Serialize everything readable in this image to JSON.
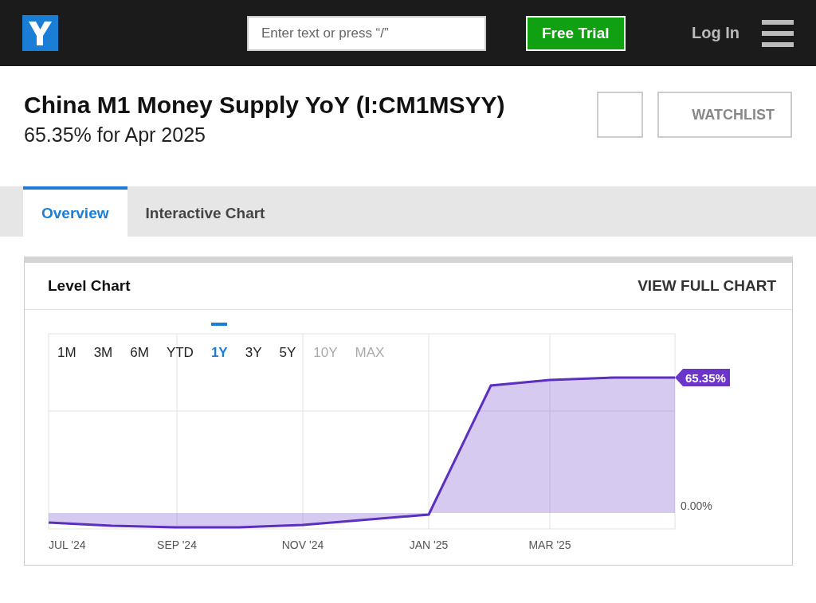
{
  "header": {
    "search": {
      "placeholder": "Enter text or press “/”"
    },
    "trial_button": "Free Trial",
    "login": "Log In"
  },
  "title": "China M1 Money Supply YoY (I:CM1MSYY)",
  "subtitle": "65.35% for Apr 2025",
  "watchlist_button": "WATCHLIST",
  "tabs": [
    {
      "label": "Overview",
      "selected": true
    },
    {
      "label": "Interactive Chart",
      "selected": false
    }
  ],
  "chart_card": {
    "title": "Level Chart",
    "link": "VIEW FULL CHART",
    "ranges": [
      {
        "label": "1M",
        "selected": false,
        "disabled": false
      },
      {
        "label": "3M",
        "selected": false,
        "disabled": false
      },
      {
        "label": "6M",
        "selected": false,
        "disabled": false
      },
      {
        "label": "YTD",
        "selected": false,
        "disabled": false
      },
      {
        "label": "1Y",
        "selected": true,
        "disabled": false
      },
      {
        "label": "3Y",
        "selected": false,
        "disabled": false
      },
      {
        "label": "5Y",
        "selected": false,
        "disabled": false
      },
      {
        "label": "10Y",
        "selected": false,
        "disabled": true
      },
      {
        "label": "MAX",
        "selected": false,
        "disabled": true
      }
    ],
    "x_labels": [
      "JUL '24",
      "SEP '24",
      "NOV '24",
      "JAN '25",
      "MAR '25"
    ],
    "zero_label": "0.00%",
    "last_value_label": "65.35%"
  }
}
